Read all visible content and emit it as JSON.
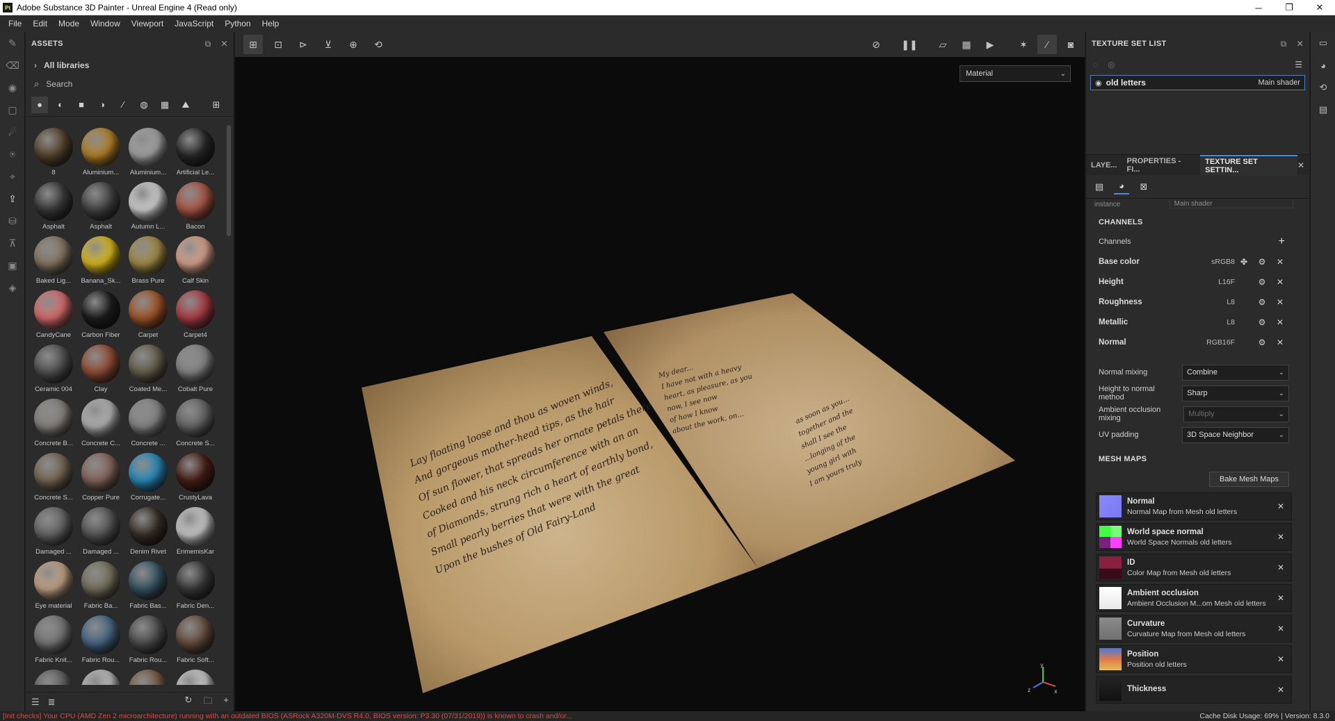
{
  "window": {
    "title": "Adobe Substance 3D Painter - Unreal Engine 4 (Read only)",
    "app_badge": "Pt",
    "minimize": "─",
    "maximize": "❐",
    "close": "✕"
  },
  "menu": [
    "File",
    "Edit",
    "Mode",
    "Window",
    "Viewport",
    "JavaScript",
    "Python",
    "Help"
  ],
  "assets": {
    "title": "ASSETS",
    "library": "All libraries",
    "search_placeholder": "Search",
    "items": [
      {
        "label": "8",
        "color": "#5a4630"
      },
      {
        "label": "Aluminium...",
        "color": "#b8862a"
      },
      {
        "label": "Aluminium...",
        "color": "#a8a8a8"
      },
      {
        "label": "Artificial Le...",
        "color": "#2a2a2a"
      },
      {
        "label": "Asphalt",
        "color": "#3b3b3b"
      },
      {
        "label": "Asphalt",
        "color": "#474747"
      },
      {
        "label": "Autumn L...",
        "color": "#d8d8d8"
      },
      {
        "label": "Bacon",
        "color": "#b05a48"
      },
      {
        "label": "Baked Lig...",
        "color": "#8a7a68"
      },
      {
        "label": "Banana_Sk...",
        "color": "#e0c020"
      },
      {
        "label": "Brass Pure",
        "color": "#a89048"
      },
      {
        "label": "Calf Skin",
        "color": "#e0a890"
      },
      {
        "label": "CandyCane",
        "color": "#e07070"
      },
      {
        "label": "Carbon Fiber",
        "color": "#1f1f1f"
      },
      {
        "label": "Carpet",
        "color": "#a85a2a"
      },
      {
        "label": "Carpet4",
        "color": "#b04048"
      },
      {
        "label": "Ceramic 004",
        "color": "#555555"
      },
      {
        "label": "Clay",
        "color": "#985038"
      },
      {
        "label": "Coated Me...",
        "color": "#6a6250"
      },
      {
        "label": "Cobalt Pure",
        "color": "#8a8a8a"
      },
      {
        "label": "Concrete B...",
        "color": "#8a8682"
      },
      {
        "label": "Concrete C...",
        "color": "#b8b8b8"
      },
      {
        "label": "Concrete ...",
        "color": "#8a8a8a"
      },
      {
        "label": "Concrete S...",
        "color": "#6a6a6a"
      },
      {
        "label": "Concrete S...",
        "color": "#7a6a58"
      },
      {
        "label": "Copper Pure",
        "color": "#8a6a60"
      },
      {
        "label": "Corrugate...",
        "color": "#2a90c0"
      },
      {
        "label": "CrustyLava",
        "color": "#4a2018"
      },
      {
        "label": "Damaged ...",
        "color": "#6a6a6a"
      },
      {
        "label": "Damaged ...",
        "color": "#5a5a5a"
      },
      {
        "label": "Denim Rivet",
        "color": "#3a3028"
      },
      {
        "label": "ErimemisKar",
        "color": "#d0d0d0"
      },
      {
        "label": "Eye material",
        "color": "#c8a888"
      },
      {
        "label": "Fabric Ba...",
        "color": "#7a7460"
      },
      {
        "label": "Fabric Bas...",
        "color": "#3a5868"
      },
      {
        "label": "Fabric Den...",
        "color": "#3c3c3c"
      },
      {
        "label": "Fabric Knit...",
        "color": "#7a7a7a"
      },
      {
        "label": "Fabric Rou...",
        "color": "#4a6a88"
      },
      {
        "label": "Fabric Rou...",
        "color": "#505050"
      },
      {
        "label": "Fabric Soft...",
        "color": "#6a5040"
      },
      {
        "label": "",
        "color": "#666666"
      },
      {
        "label": "",
        "color": "#c0c0c0"
      },
      {
        "label": "",
        "color": "#7a6048"
      },
      {
        "label": "",
        "color": "#d0d0d0"
      }
    ]
  },
  "viewport": {
    "material_select": "Material",
    "axis": {
      "x": "x",
      "y": "y",
      "z": "z"
    },
    "left_page_lines": [
      "Lay floating loose and thou as woven winds,",
      "And gorgeous mother-head tips, as the hair",
      "Of sun flower, that spreads her ornate petals there",
      "Cooked and his neck circumference with an an",
      "of Diamonds, strung rich a heart of earthly bond,",
      "Small pearly berries that were with the great",
      "Upon the bushes of Old Fairy-Land"
    ],
    "right_page_lines_a": [
      "My dear...",
      "I have not with a heavy",
      "heart, as pleasure, as you",
      "now, I see now",
      "of how I know",
      "about the work, on..."
    ],
    "right_page_lines_b": [
      "as soon as you...",
      "together and the",
      "shall I see the",
      "...longing of the",
      "young girl with",
      "I am yours truly"
    ]
  },
  "texture_set_list": {
    "title": "TEXTURE SET LIST",
    "item_name": "old letters",
    "item_shader": "Main shader"
  },
  "tabs": [
    {
      "label": "LAYE...",
      "active": false
    },
    {
      "label": "PROPERTIES - FI...",
      "active": false
    },
    {
      "label": "TEXTURE SET SETTIN...",
      "active": true
    }
  ],
  "settings": {
    "shader_instance_label": "Shader instance",
    "shader_instance_value": "Main shader",
    "channels_title": "CHANNELS",
    "channels_label": "Channels",
    "channels": [
      {
        "name": "Base color",
        "format": "sRGB8",
        "extra_icon": "✤"
      },
      {
        "name": "Height",
        "format": "L16F",
        "extra_icon": ""
      },
      {
        "name": "Roughness",
        "format": "L8",
        "extra_icon": ""
      },
      {
        "name": "Metallic",
        "format": "L8",
        "extra_icon": ""
      },
      {
        "name": "Normal",
        "format": "RGB16F",
        "extra_icon": ""
      }
    ],
    "normal_mixing": {
      "label": "Normal mixing",
      "value": "Combine"
    },
    "height_to_normal": {
      "label": "Height to normal method",
      "value": "Sharp"
    },
    "ao_mixing": {
      "label": "Ambient occlusion mixing",
      "value": "Multiply"
    },
    "uv_padding": {
      "label": "UV padding",
      "value": "3D Space Neighbor"
    },
    "mesh_maps_title": "MESH MAPS",
    "bake_button": "Bake Mesh Maps",
    "mesh_maps": [
      {
        "name": "Normal",
        "desc": "Normal Map from Mesh old letters",
        "thumb": "normal"
      },
      {
        "name": "World space normal",
        "desc": "World Space Normals old letters",
        "thumb": "world"
      },
      {
        "name": "ID",
        "desc": "Color Map from Mesh old letters",
        "thumb": "id"
      },
      {
        "name": "Ambient occlusion",
        "desc": "Ambient Occlusion M...om Mesh old letters",
        "thumb": "ao"
      },
      {
        "name": "Curvature",
        "desc": "Curvature Map from Mesh old letters",
        "thumb": "curv"
      },
      {
        "name": "Position",
        "desc": "Position old letters",
        "thumb": "pos"
      },
      {
        "name": "Thickness",
        "desc": "",
        "thumb": "thick"
      }
    ]
  },
  "status": {
    "warning": "[Init checks] Your CPU (AMD Zen 2 microarchitecture) running with an outdated BIOS (ASRock A320M-DVS R4.0, BIOS version: P3.30 (07/31/2019)) is known to crash and/or...",
    "cache": "Cache Disk Usage:   69%  |  Version: 8.3.0"
  }
}
